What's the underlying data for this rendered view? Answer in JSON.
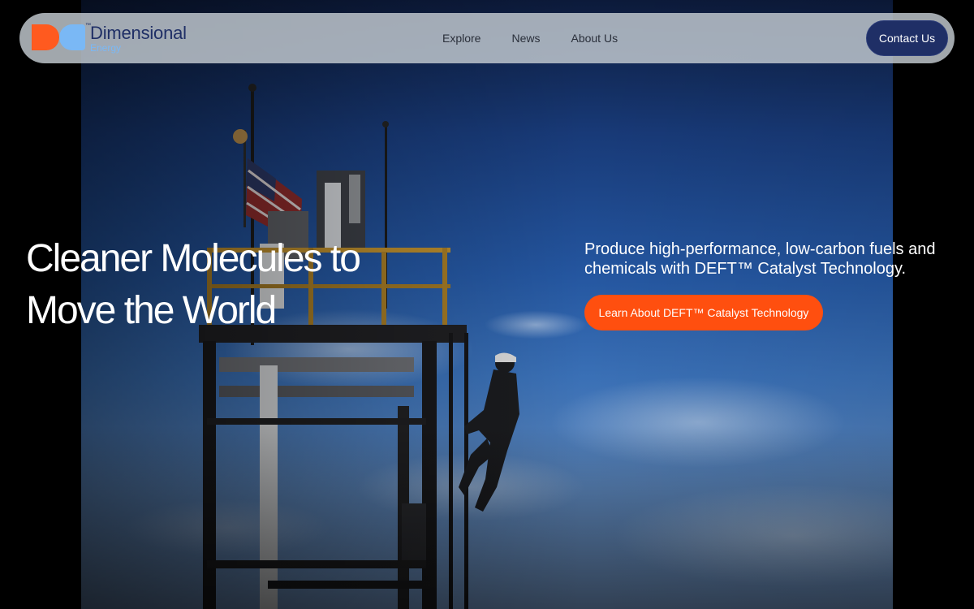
{
  "brand": {
    "name": "Dimensional",
    "sub": "Energy",
    "tm": "™",
    "colors": {
      "orange": "#ff5a1f",
      "blue": "#7ab8f5",
      "navy": "#1f2f66"
    }
  },
  "nav": {
    "links": [
      "Explore",
      "News",
      "About Us"
    ],
    "contact_label": "Contact Us"
  },
  "hero": {
    "headline": "Cleaner Molecules to Move the World",
    "subtext": "Produce high-performance, low-carbon fuels and chemicals with DEFT™ Catalyst Technology.",
    "cta_label": "Learn About DEFT™ Catalyst Technology",
    "cta_color": "#ff4f0f"
  }
}
